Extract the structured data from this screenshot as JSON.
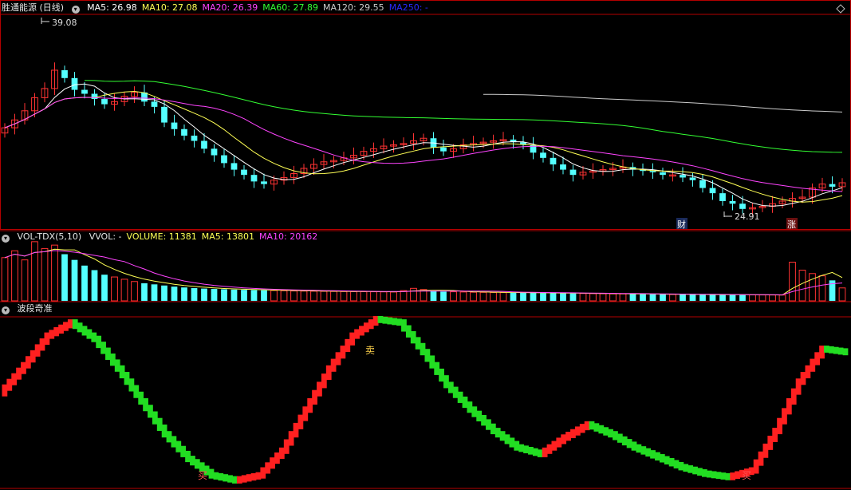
{
  "panels": {
    "price": {
      "title": "胜通能源 (日线)",
      "ma_labels": [
        {
          "text": "MA5: 26.98",
          "color": "#ffffff"
        },
        {
          "text": "MA10: 27.08",
          "color": "#ffff55"
        },
        {
          "text": "MA20: 26.39",
          "color": "#ff44ff"
        },
        {
          "text": "MA60: 27.89",
          "color": "#33ff33"
        },
        {
          "text": "MA120: 29.55",
          "color": "#cccccc"
        },
        {
          "text": "MA250: -",
          "color": "#2a2aff"
        }
      ],
      "high_label": "39.08",
      "low_label": "24.91",
      "marker_cai": "财",
      "marker_zhang": "涨"
    },
    "volume": {
      "title": "VOL-TDX(5,10)",
      "labels": [
        {
          "text": "VVOL: -",
          "color": "#e6e6e6"
        },
        {
          "text": "VOLUME: 11381",
          "color": "#ffff55"
        },
        {
          "text": "MA5: 13801",
          "color": "#ffff55"
        },
        {
          "text": "MA10: 20162",
          "color": "#ff44ff"
        }
      ]
    },
    "wave": {
      "title": "波段奇准",
      "buy_label": "买",
      "sell_label": "卖"
    }
  },
  "colors": {
    "up": "#ff3333",
    "down": "#54ffff",
    "wave_up": "#ff2020",
    "wave_down": "#22dd22",
    "ma5": "#ffffff",
    "ma10": "#ffff55",
    "ma20": "#ff44ff",
    "ma60": "#33ff33",
    "ma120": "#cccccc",
    "border": "#b40000"
  },
  "chart_data": [
    {
      "type": "candlestick",
      "title": "胜通能源 (日线)",
      "y_marked": {
        "high": 39.08,
        "low": 24.91
      },
      "close_approx": [
        31.2,
        31.8,
        32.5,
        33.5,
        34.2,
        35.6,
        35.0,
        34.1,
        33.8,
        33.4,
        33.0,
        33.2,
        33.6,
        33.9,
        33.2,
        32.8,
        31.6,
        31.1,
        30.6,
        30.2,
        29.6,
        29.1,
        28.5,
        28.0,
        27.6,
        27.1,
        26.9,
        27.2,
        27.4,
        27.7,
        28.1,
        28.4,
        28.6,
        28.7,
        28.9,
        29.1,
        29.4,
        29.6,
        29.8,
        29.9,
        30.0,
        30.2,
        30.4,
        29.7,
        29.4,
        29.6,
        29.9,
        30.0,
        30.1,
        30.2,
        30.3,
        30.1,
        29.9,
        29.3,
        28.9,
        28.4,
        28.0,
        27.6,
        27.8,
        27.9,
        28.0,
        28.1,
        28.2,
        28.0,
        27.9,
        27.8,
        27.6,
        27.6,
        27.4,
        27.2,
        26.6,
        26.2,
        25.6,
        25.4,
        25.0,
        25.1,
        25.2,
        25.4,
        25.6,
        25.8,
        25.9,
        26.6,
        26.9,
        26.7,
        27.0
      ],
      "volume_approx": [
        38000,
        44000,
        36000,
        52000,
        46000,
        49000,
        41000,
        36000,
        31000,
        27000,
        23000,
        21000,
        19000,
        17000,
        15500,
        14500,
        13500,
        12500,
        11800,
        11200,
        10800,
        10500,
        10200,
        9900,
        9700,
        9500,
        9300,
        9100,
        8900,
        8700,
        8600,
        8500,
        8400,
        8300,
        8200,
        8100,
        8050,
        8000,
        7900,
        7800,
        9000,
        11000,
        10000,
        8500,
        8200,
        8000,
        7800,
        7600,
        7500,
        7400,
        7300,
        7200,
        7100,
        7000,
        6900,
        6800,
        6700,
        6600,
        6500,
        6400,
        6300,
        6200,
        6100,
        6000,
        5900,
        5800,
        5700,
        5650,
        5600,
        5550,
        5500,
        5450,
        5400,
        5350,
        5300,
        5250,
        5200,
        5150,
        5100,
        34000,
        27000,
        24000,
        22000,
        18000,
        11381
      ]
    },
    {
      "type": "area",
      "title": "波段奇准",
      "values_approx": [
        0.55,
        0.72,
        0.9,
        0.98,
        0.88,
        0.7,
        0.5,
        0.3,
        0.15,
        0.05,
        0.02,
        0.05,
        0.2,
        0.45,
        0.7,
        0.9,
        1.0,
        0.98,
        0.8,
        0.6,
        0.45,
        0.32,
        0.22,
        0.18,
        0.28,
        0.36,
        0.3,
        0.22,
        0.16,
        0.1,
        0.06,
        0.04,
        0.08,
        0.32,
        0.62,
        0.82,
        0.8
      ]
    }
  ]
}
